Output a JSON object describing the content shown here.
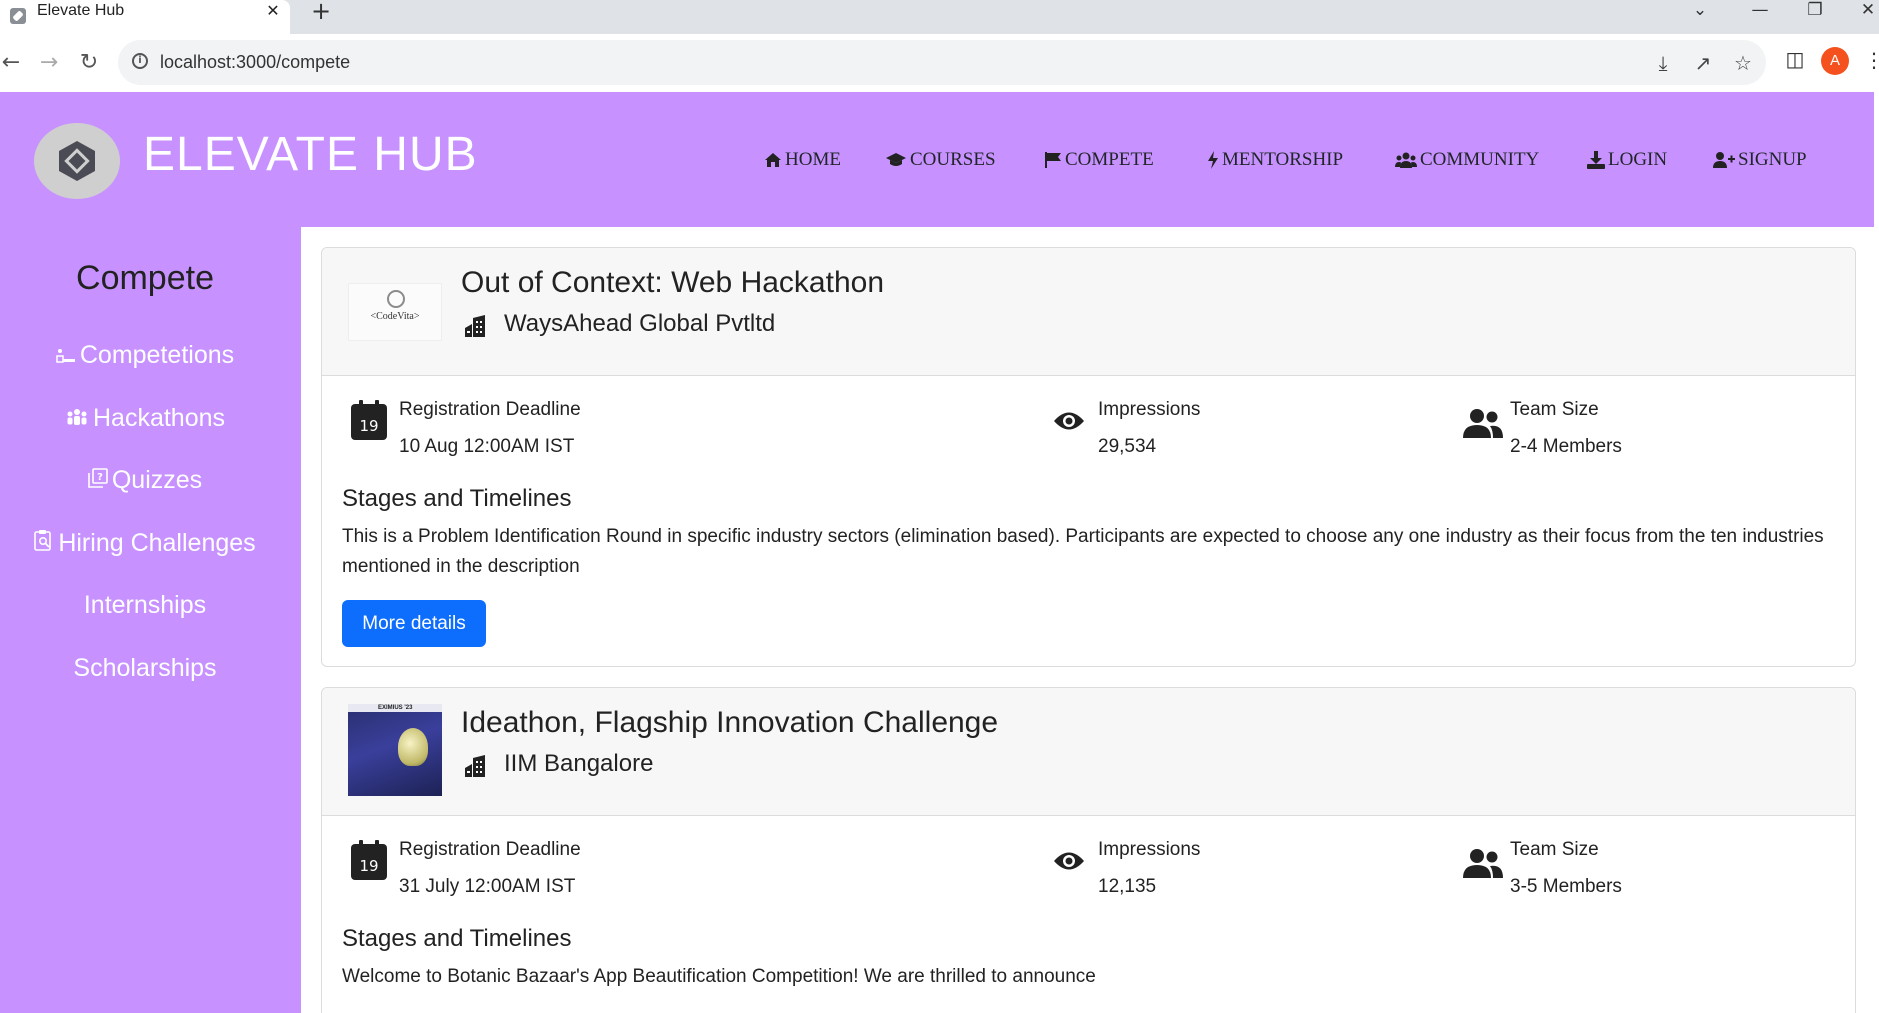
{
  "browser": {
    "tab_title": "Elevate Hub",
    "tab_close": "✕",
    "new_tab": "+",
    "url": "localhost:3000/compete",
    "profile_initial": "A",
    "window_controls": {
      "dropdown": "⌄",
      "minimize": "—",
      "restore": "❐",
      "close": "✕"
    }
  },
  "header": {
    "brand": "ELEVATE HUB",
    "nav": [
      {
        "label": "HOME",
        "icon": "home-icon"
      },
      {
        "label": "COURSES",
        "icon": "graduation-cap-icon"
      },
      {
        "label": "COMPETE",
        "icon": "flag-icon"
      },
      {
        "label": "MENTORSHIP",
        "icon": "bolt-icon"
      },
      {
        "label": "COMMUNITY",
        "icon": "users-icon"
      },
      {
        "label": "LOGIN",
        "icon": "download-icon"
      },
      {
        "label": "SIGNUP",
        "icon": "user-plus-icon"
      }
    ]
  },
  "sidebar": {
    "title": "Compete",
    "items": [
      {
        "label": "Competetions",
        "icon": "podium-icon"
      },
      {
        "label": "Hackathons",
        "icon": "people-group-icon"
      },
      {
        "label": "Quizzes",
        "icon": "quiz-icon"
      },
      {
        "label": "Hiring Challenges",
        "icon": "search-clipboard-icon"
      },
      {
        "label": "Internships",
        "icon": ""
      },
      {
        "label": "Scholarships",
        "icon": ""
      }
    ]
  },
  "cards": [
    {
      "title": "Out of Context: Web Hackathon",
      "organization": "WaysAhead Global Pvtltd",
      "thumb_text": "<CodeVita>",
      "calendar_day": "19",
      "deadline_label": "Registration Deadline",
      "deadline_value": "10 Aug 12:00AM IST",
      "impressions_label": "Impressions",
      "impressions_value": "29,534",
      "team_label": "Team Size",
      "team_value": "2-4 Members",
      "stages_heading": "Stages and Timelines",
      "description": "This is a Problem Identification Round in specific industry sectors (elimination based). Participants are expected to choose any one industry as their focus from the ten industries mentioned in the description",
      "button": "More details"
    },
    {
      "title": "Ideathon, Flagship Innovation Challenge",
      "organization": "IIM Bangalore",
      "thumb_text": "EXIMIUS '23",
      "calendar_day": "19",
      "deadline_label": "Registration Deadline",
      "deadline_value": "31 July 12:00AM IST",
      "impressions_label": "Impressions",
      "impressions_value": "12,135",
      "team_label": "Team Size",
      "team_value": "3-5 Members",
      "stages_heading": "Stages and Timelines",
      "description": "Welcome to Botanic Bazaar's App Beautification Competition! We are thrilled to announce"
    }
  ]
}
